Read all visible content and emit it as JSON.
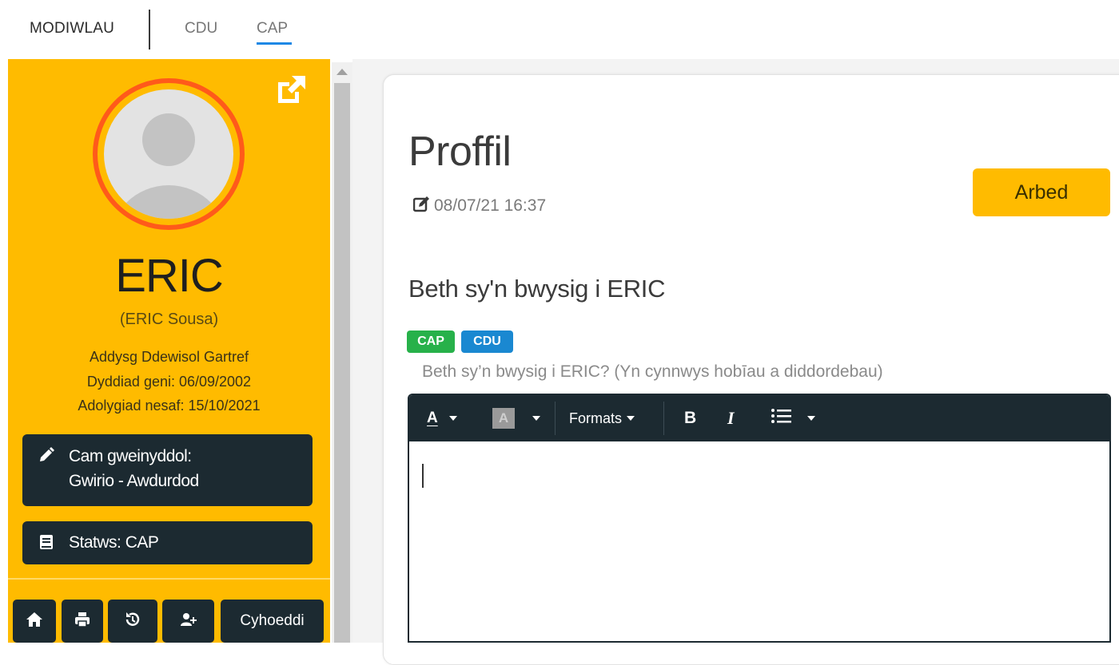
{
  "nav": {
    "main_label": "MODIWLAU",
    "tabs": [
      {
        "label": "CDU",
        "active": false
      },
      {
        "label": "CAP",
        "active": true
      }
    ],
    "active_color": "#1e88e5"
  },
  "sidebar": {
    "background": "#ffbb00",
    "avatar_ring_color": "#ff5a1a",
    "name": "ERIC",
    "full_name": "(ERIC Sousa)",
    "info": {
      "education": "Addysg Ddewisol Gartref",
      "birth_date": "Dyddiad geni: 06/09/2002",
      "next_review": "Adolygiad nesaf: 15/10/2021"
    },
    "admin_stage": {
      "line1": "Cam gweinyddol:",
      "line2": "Gwirio - Awdurdod",
      "icon": "pencil-icon"
    },
    "status": {
      "label": "Statws: CAP",
      "icon": "book-icon"
    },
    "actions": {
      "home_icon": "home-icon",
      "print_icon": "print-icon",
      "history_icon": "history-icon",
      "add_user_icon": "user-plus-icon",
      "publish_label": "Cyhoeddi"
    }
  },
  "main": {
    "title": "Proffil",
    "last_edited": "08/07/21 16:37",
    "save_label": "Arbed",
    "section": {
      "title": "Beth sy'n bwysig i ERIC",
      "tags": [
        {
          "label": "CAP",
          "color": "#27b14a"
        },
        {
          "label": "CDU",
          "color": "#1a88d1"
        }
      ],
      "hint": "Beth sy’n bwysig i ERIC? (Yn cynnwys hobīau a diddordebau)"
    },
    "editor": {
      "toolbar": {
        "font_color_label": "A",
        "bg_color_label": "A",
        "formats_label": "Formats",
        "bold_label": "B",
        "italic_label": "I"
      },
      "content": ""
    }
  }
}
